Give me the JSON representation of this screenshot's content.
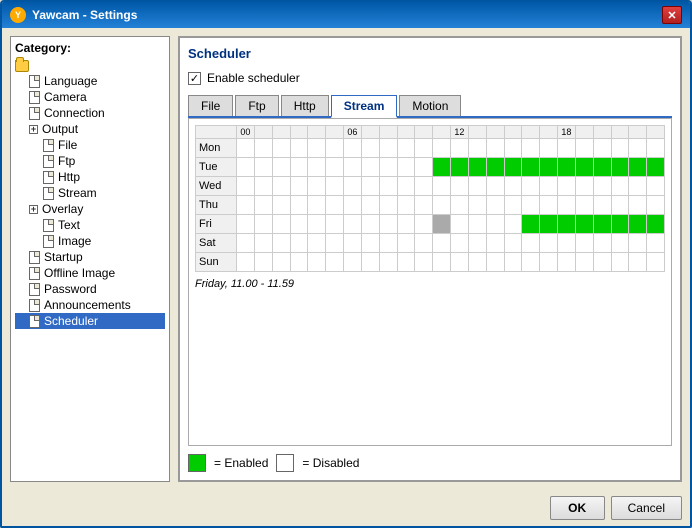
{
  "window": {
    "title": "Yawcam - Settings",
    "close_label": "✕"
  },
  "sidebar": {
    "category_label": "Category:",
    "items": [
      {
        "id": "root",
        "label": "",
        "type": "folder",
        "indent": 0
      },
      {
        "id": "language",
        "label": "Language",
        "type": "doc",
        "indent": 1
      },
      {
        "id": "camera",
        "label": "Camera",
        "type": "doc",
        "indent": 1
      },
      {
        "id": "connection",
        "label": "Connection",
        "type": "doc",
        "indent": 1
      },
      {
        "id": "output",
        "label": "Output",
        "type": "folder",
        "indent": 1,
        "expandable": true
      },
      {
        "id": "file",
        "label": "File",
        "type": "doc",
        "indent": 2
      },
      {
        "id": "ftp",
        "label": "Ftp",
        "type": "doc",
        "indent": 2
      },
      {
        "id": "http",
        "label": "Http",
        "type": "doc",
        "indent": 2
      },
      {
        "id": "stream",
        "label": "Stream",
        "type": "doc",
        "indent": 2
      },
      {
        "id": "overlay",
        "label": "Overlay",
        "type": "folder",
        "indent": 1,
        "expandable": true
      },
      {
        "id": "text",
        "label": "Text",
        "type": "doc",
        "indent": 2
      },
      {
        "id": "image",
        "label": "Image",
        "type": "doc",
        "indent": 2
      },
      {
        "id": "startup",
        "label": "Startup",
        "type": "doc",
        "indent": 1
      },
      {
        "id": "offline-image",
        "label": "Offline Image",
        "type": "doc",
        "indent": 1
      },
      {
        "id": "password",
        "label": "Password",
        "type": "doc",
        "indent": 1
      },
      {
        "id": "announcements",
        "label": "Announcements",
        "type": "doc",
        "indent": 1
      },
      {
        "id": "scheduler",
        "label": "Scheduler",
        "type": "doc",
        "indent": 1,
        "selected": true
      }
    ]
  },
  "scheduler": {
    "panel_title": "Scheduler",
    "enable_label": "Enable scheduler",
    "enable_checked": true,
    "tabs": [
      {
        "id": "file",
        "label": "File",
        "active": false
      },
      {
        "id": "ftp",
        "label": "Ftp",
        "active": false
      },
      {
        "id": "http",
        "label": "Http",
        "active": false
      },
      {
        "id": "stream",
        "label": "Stream",
        "active": true
      },
      {
        "id": "motion",
        "label": "Motion",
        "active": false
      }
    ],
    "days": [
      "Mon",
      "Tue",
      "Wed",
      "Thu",
      "Fri",
      "Sat",
      "Sun"
    ],
    "status_text": "Friday, 11.00 - 11.59",
    "legend": {
      "enabled_label": "= Enabled",
      "disabled_label": "= Disabled"
    },
    "grid": {
      "Mon": [],
      "Tue": [
        11,
        12,
        13,
        14,
        15,
        16,
        17,
        18,
        19,
        20,
        21,
        22,
        23
      ],
      "Wed": [],
      "Thu": [],
      "Fri": [
        16,
        17,
        18,
        19,
        20,
        21,
        22,
        23
      ],
      "Sat": [],
      "Sun": []
    },
    "hovered_cell": {
      "day": "Fri",
      "hour": 11
    }
  },
  "footer": {
    "ok_label": "OK",
    "cancel_label": "Cancel"
  }
}
